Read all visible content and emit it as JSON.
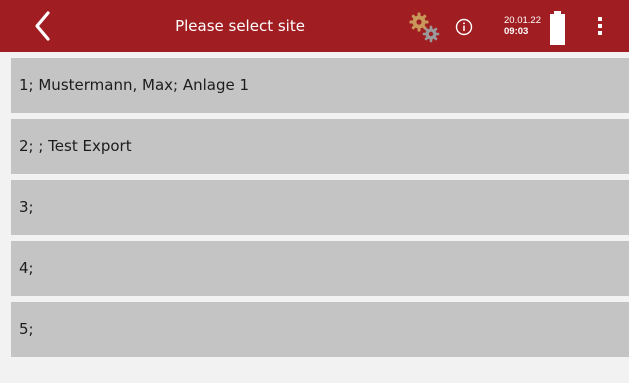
{
  "header": {
    "title": "Please select site",
    "date": "20.01.22",
    "time": "09:03",
    "back_icon": "chevron-left-icon",
    "settings_icon": "gears-icon",
    "info_icon": "info-circle-icon",
    "battery_icon": "battery-full-icon",
    "menu_icon": "more-vertical-icon",
    "accent_color": "#a01d22",
    "gear_color": "#c8995a"
  },
  "sites": [
    {
      "label": "1; Mustermann, Max; Anlage 1"
    },
    {
      "label": "2; ; Test Export"
    },
    {
      "label": "3;"
    },
    {
      "label": "4;"
    },
    {
      "label": "5;"
    }
  ]
}
